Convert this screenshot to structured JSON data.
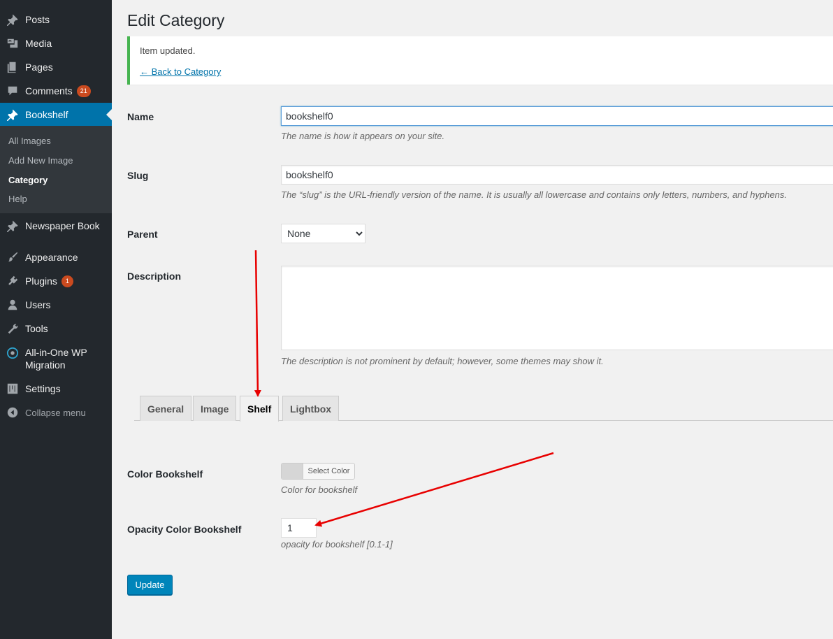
{
  "sidebar": {
    "items": [
      {
        "label": "Posts",
        "icon": "pushpin-icon"
      },
      {
        "label": "Media",
        "icon": "media-icon"
      },
      {
        "label": "Pages",
        "icon": "pages-icon"
      },
      {
        "label": "Comments",
        "icon": "comment-icon",
        "badge": "21"
      },
      {
        "label": "Bookshelf",
        "icon": "pushpin-icon",
        "active": true
      },
      {
        "label": "Newspaper Book",
        "icon": "pushpin-icon"
      },
      {
        "label": "Appearance",
        "icon": "paintbrush-icon"
      },
      {
        "label": "Plugins",
        "icon": "plugin-icon",
        "badge": "1"
      },
      {
        "label": "Users",
        "icon": "users-icon"
      },
      {
        "label": "Tools",
        "icon": "wrench-icon"
      },
      {
        "label": "All-in-One WP Migration",
        "line1": "All-in-One WP",
        "line2": "Migration",
        "icon": "migration-icon"
      },
      {
        "label": "Settings",
        "icon": "settings-icon"
      },
      {
        "label": "Collapse menu",
        "icon": "collapse-icon"
      }
    ],
    "submenu": [
      {
        "label": "All Images"
      },
      {
        "label": "Add New Image"
      },
      {
        "label": "Category",
        "current": true
      },
      {
        "label": "Help"
      }
    ]
  },
  "page": {
    "title": "Edit Category"
  },
  "notice": {
    "message": "Item updated.",
    "back_link": "← Back to Category",
    "border_color": "#46b450"
  },
  "form": {
    "name": {
      "label": "Name",
      "value": "bookshelf0",
      "description": "The name is how it appears on your site."
    },
    "slug": {
      "label": "Slug",
      "value": "bookshelf0",
      "description": "The “slug” is the URL-friendly version of the name. It is usually all lowercase and contains only letters, numbers, and hyphens."
    },
    "parent": {
      "label": "Parent",
      "selected": "None"
    },
    "description": {
      "label": "Description",
      "value": "",
      "help": "The description is not prominent by default; however, some themes may show it."
    }
  },
  "tabs": [
    {
      "label": "General"
    },
    {
      "label": "Image"
    },
    {
      "label": "Shelf",
      "active": true
    },
    {
      "label": "Lightbox"
    }
  ],
  "shelf": {
    "color": {
      "label": "Color Bookshelf",
      "button": "Select Color",
      "help": "Color for bookshelf"
    },
    "opacity": {
      "label": "Opacity Color Bookshelf",
      "value": "1",
      "help": "opacity for bookshelf [0.1-1]"
    }
  },
  "update_button": "Update",
  "colors": {
    "sidebar_bg": "#23282d",
    "active_menu": "#0073aa",
    "primary_button": "#0085ba",
    "annotation_arrow": "#e80000"
  }
}
